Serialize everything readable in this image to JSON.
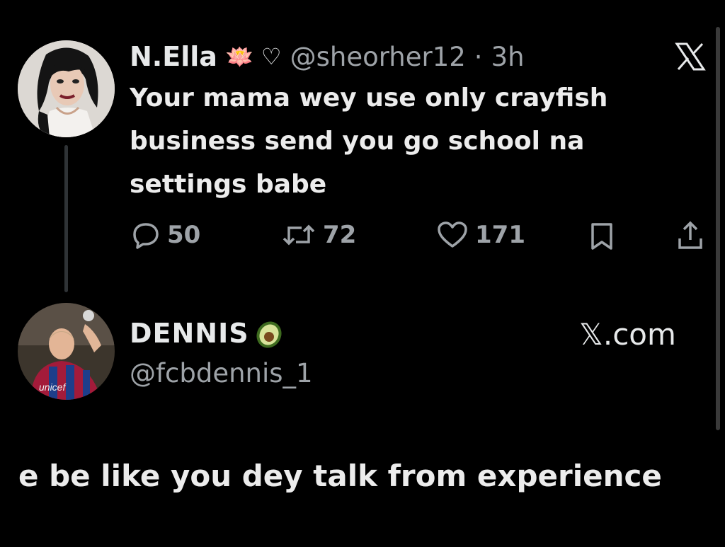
{
  "original_tweet": {
    "display_name": "N.Ella",
    "name_emojis": "🪷 ♡",
    "handle": "@sheorher12",
    "separator": "·",
    "time": "3h",
    "source_logo": "X",
    "text": "Your mama wey use only crayfish business send you go school na settings babe",
    "actions": {
      "replies": "50",
      "retweets": "72",
      "likes": "171"
    },
    "icons": [
      "reply-icon",
      "retweet-icon",
      "like-icon",
      "bookmark-icon",
      "share-icon"
    ]
  },
  "reply": {
    "display_name": "DENNIS",
    "name_emoji": "avocado-icon",
    "handle": "@fcbdennis_1",
    "source": "𝕏.com",
    "avatar_shirt_text": "unicef",
    "text": "e be like you dey talk from experience"
  },
  "colors": {
    "background": "#000000",
    "primary_text": "#e7e9ea",
    "secondary_text": "#9ea3a8"
  }
}
